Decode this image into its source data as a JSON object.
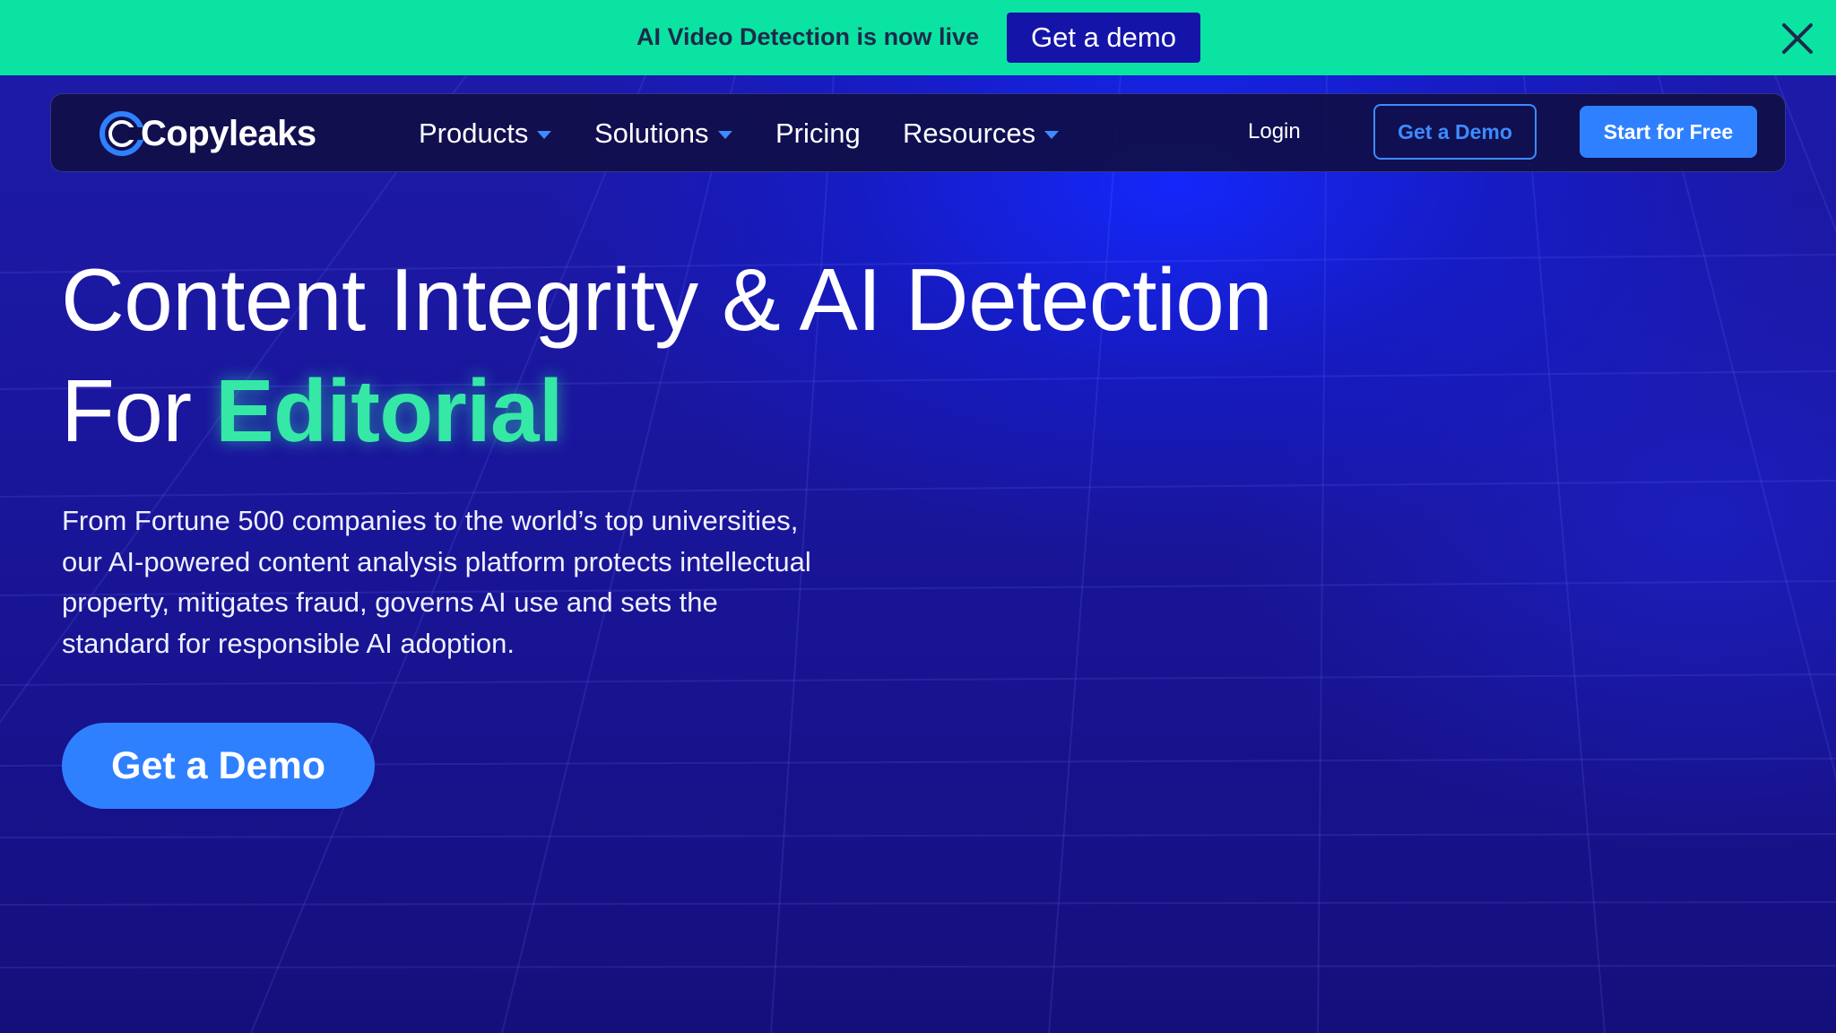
{
  "announcement": {
    "text": "AI Video Detection is now live",
    "button_label": "Get a demo",
    "close_icon": "close-icon"
  },
  "navbar": {
    "logo_text": "Copyleaks",
    "items": [
      {
        "label": "Products",
        "has_dropdown": true
      },
      {
        "label": "Solutions",
        "has_dropdown": true
      },
      {
        "label": "Pricing",
        "has_dropdown": false
      },
      {
        "label": "Resources",
        "has_dropdown": true
      }
    ],
    "login_label": "Login",
    "demo_label": "Get a Demo",
    "start_label": "Start for Free"
  },
  "hero": {
    "title_line1": "Content Integrity & AI Detection",
    "title_prefix": "For",
    "title_accent": "Editorial",
    "description": "From Fortune 500 companies to the world’s top universities, our AI-powered content analysis platform protects intellectual property, mitigates fraud, governs AI use and sets the standard for responsible AI adoption.",
    "cta_label": "Get a Demo"
  },
  "colors": {
    "announcement_bg": "#0be3a3",
    "primary_blue": "#2f80ff",
    "accent_green": "#35e8a6",
    "hero_bg": "#1a169c",
    "demo_button_bg": "#1414a8"
  }
}
